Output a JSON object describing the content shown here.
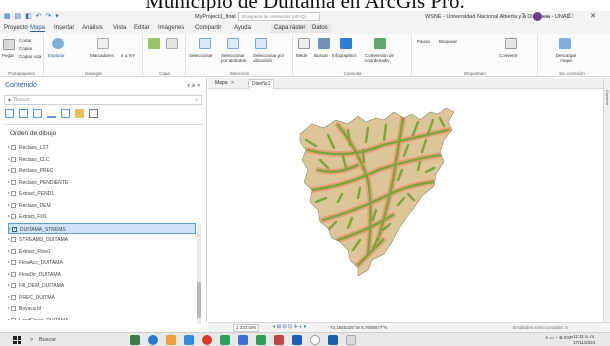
{
  "caption": "Municipio de Duitama en ArcGis Pro.",
  "window": {
    "project_name": "MyProject1_final",
    "command_search_placeholder": "Búsqueda de comandos (Alt+Q)",
    "user_label": "WSNE - Universidad Nacional Abierta y a Distancia - UNAD",
    "window_controls": "?  —  □  ✕"
  },
  "ribbon_tabs": [
    "Proyecto",
    "Mapa",
    "Insertar",
    "Análisis",
    "Vista",
    "Editar",
    "Imágenes",
    "Compartir",
    "Ayuda",
    "Capa ráster",
    "Datos"
  ],
  "active_tab": "Mapa",
  "ribbon": {
    "portapapeles": {
      "name": "Portapapeles",
      "pegar": "Pegar",
      "cortar": "Cortar",
      "copiar": "Copiar",
      "copiar_ruta": "Copiar ruta"
    },
    "navegar": {
      "name": "Navegar",
      "explorar": "Explorar",
      "marcadores": "Marcadores",
      "ir_a_xy": "Ir a XY"
    },
    "capa": {
      "name": "Capa"
    },
    "seleccion": {
      "name": "Selección",
      "seleccionar": "Seleccionar",
      "por_atributos": "Seleccionar por atributos",
      "por_ubicacion": "Seleccionar por ubicación"
    },
    "consulta": {
      "name": "Consulta",
      "medir": "Medir",
      "buscar": "Buscar",
      "infographics": "Infographics",
      "conversion": "Conversión de coordenada"
    },
    "etiquetado": {
      "name": "Etiquetado",
      "pausa": "Pausa",
      "bloquear": "Bloquear",
      "convertir": "Convertir"
    },
    "sin_conexion": {
      "name": "Sin conexión",
      "descargar": "Descargar mapa"
    }
  },
  "contents_pane": {
    "title": "Contenido",
    "controls": "▾ ⊕ ✕",
    "search_placeholder": "Buscar",
    "section_title": "Orden de dibujo",
    "selected_layer": "DUITAMA_STREMS",
    "layers": [
      "Reclass_LST",
      "Reclass_CLC",
      "Reclass_PREC",
      "Reclass_PENDIENTE",
      "Extract_PEND1",
      "Reclass_DEM",
      "Extract_Fill1",
      "DUITAMA_STREMS",
      "STREAMS_DUITAMA",
      "Extract_Flow1",
      "FlowAcc_DUITAMA",
      "FlowDir_DUITAMA",
      "Fill_DEM_DUITAMA",
      "PREC_DUITMA",
      "Boyaca.tif",
      "LandCover_DUITAMA",
      "DEM_DUITAMA.tif",
      "Escala_DUITAMA.tif"
    ]
  },
  "map_tabs": [
    {
      "label": "Mapa",
      "active": false
    },
    {
      "label": "Diseño1",
      "active": true
    }
  ],
  "status_bar": {
    "scale": "1:233.596",
    "coordinates": "73,1655325°W 5,7605677°N",
    "selected_features": "Entidades seleccionadas: 0"
  },
  "right_sidebar_label": "Exportar",
  "taskbar": {
    "search_placeholder": "Buscar",
    "tray_lang": "ESP",
    "time": "11:11 a. m.",
    "date": "17/11/2024"
  },
  "colors": {
    "accent": "#2b5f9e",
    "map_green": "#7da33c",
    "map_salmon": "#e6a27a",
    "map_tan": "#dcc596"
  }
}
